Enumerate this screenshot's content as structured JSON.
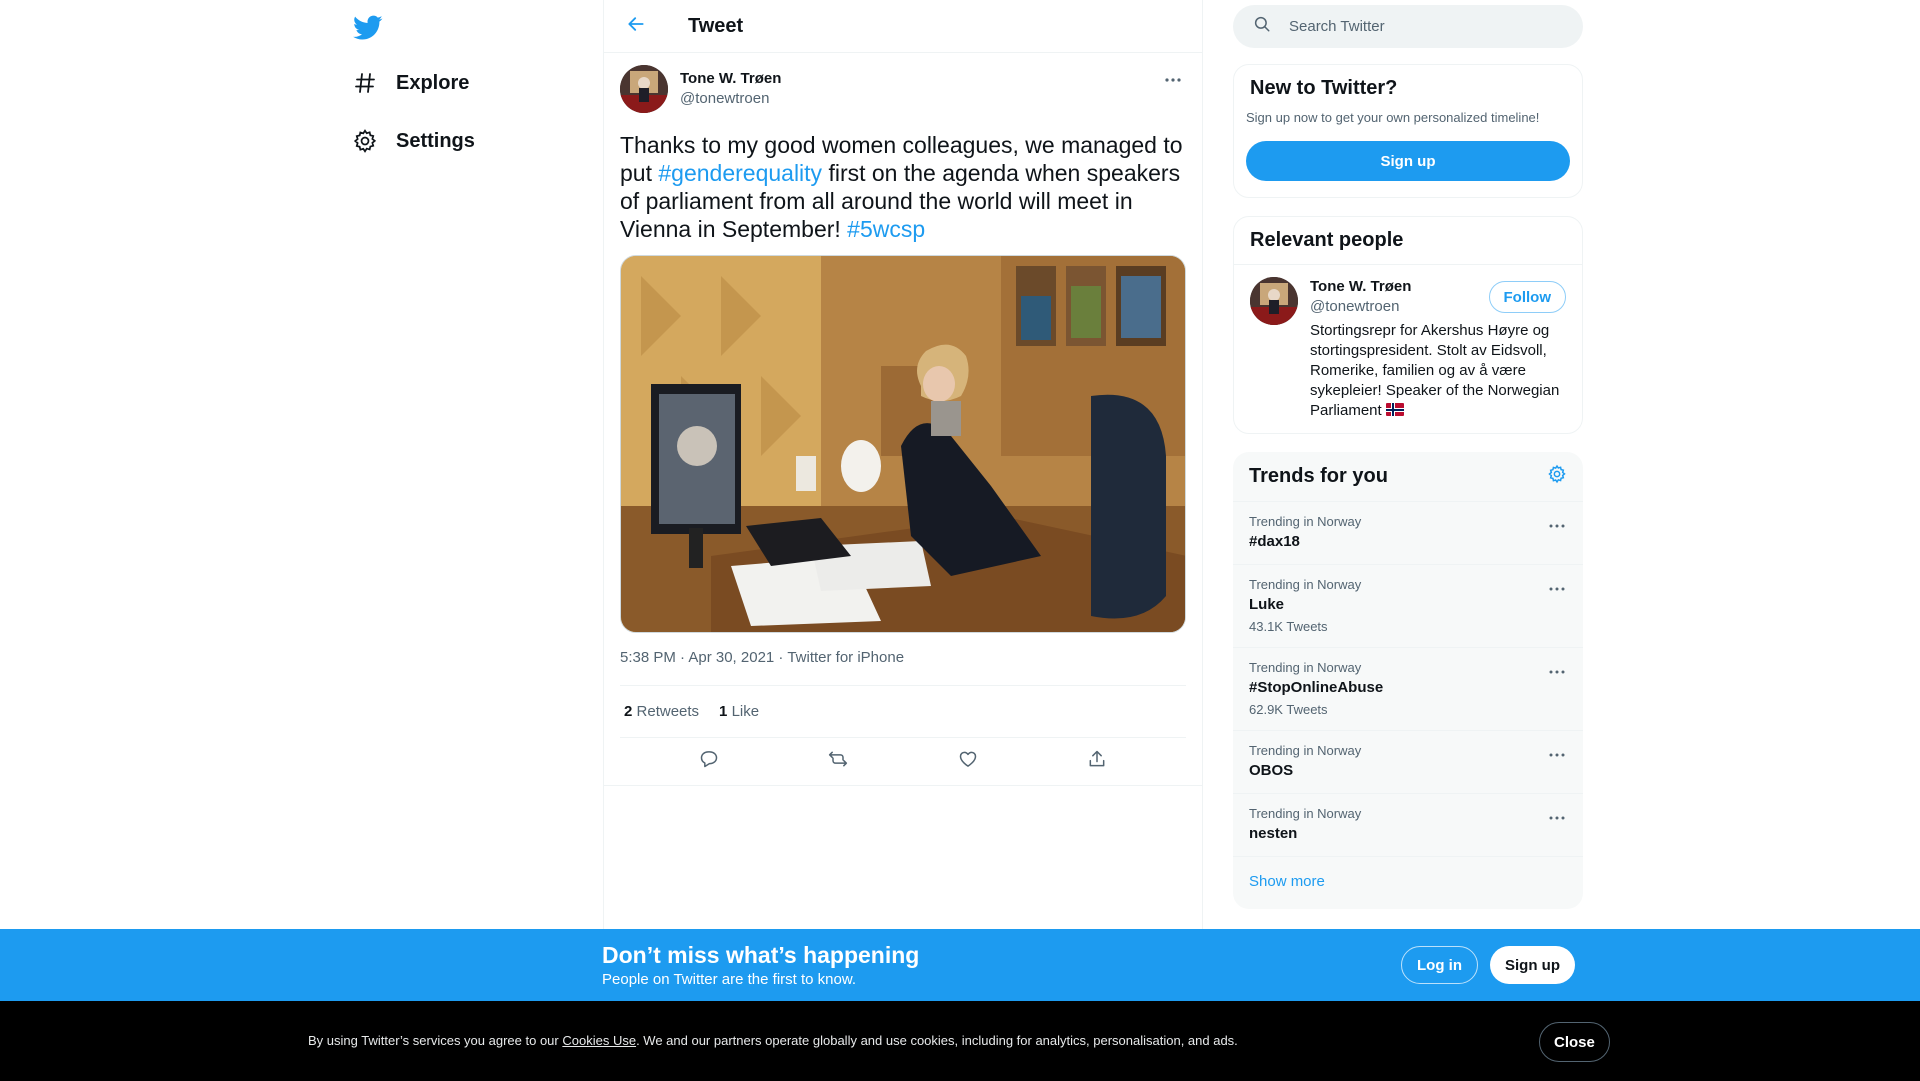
{
  "nav": {
    "logo_icon": "twitter-bird-icon",
    "items": [
      {
        "label": "Explore",
        "icon": "hashtag-icon"
      },
      {
        "label": "Settings",
        "icon": "gear-icon"
      }
    ]
  },
  "header": {
    "title": "Tweet",
    "back_icon": "arrow-left-icon"
  },
  "tweet": {
    "author_name": "Tone W. Trøen",
    "author_handle": "@tonewtroen",
    "text_parts": [
      "Thanks to my good women colleagues, we managed to put ",
      "#genderequality",
      " first on the agenda when speakers of parliament from all around the world will meet in Vienna in September! ",
      "#5wcsp"
    ],
    "timestamp": "5:38 PM · Apr 30, 2021 · Twitter for iPhone",
    "retweets_count": "2",
    "retweets_label": "Retweets",
    "likes_count": "1",
    "likes_label": "Like"
  },
  "search": {
    "placeholder": "Search Twitter"
  },
  "new_to_twitter": {
    "title": "New to Twitter?",
    "subtitle": "Sign up now to get your own personalized timeline!",
    "button": "Sign up"
  },
  "relevant_people": {
    "title": "Relevant people",
    "person": {
      "name": "Tone W. Trøen",
      "handle": "@tonewtroen",
      "bio": "Stortingsrepr for Akershus Høyre og stortingspresident. Stolt av Eidsvoll, Romerike, familien og av å være sykepleier! Speaker of the Norwegian Parliament",
      "follow_label": "Follow"
    }
  },
  "trends": {
    "title": "Trends for you",
    "items": [
      {
        "context": "Trending in Norway",
        "name": "#dax18",
        "count": ""
      },
      {
        "context": "Trending in Norway",
        "name": "Luke",
        "count": "43.1K Tweets"
      },
      {
        "context": "Trending in Norway",
        "name": "#StopOnlineAbuse",
        "count": "62.9K Tweets"
      },
      {
        "context": "Trending in Norway",
        "name": "OBOS",
        "count": ""
      },
      {
        "context": "Trending in Norway",
        "name": "nesten",
        "count": ""
      }
    ],
    "show_more": "Show more"
  },
  "banner": {
    "title": "Don’t miss what’s happening",
    "subtitle": "People on Twitter are the first to know.",
    "login": "Log in",
    "signup": "Sign up"
  },
  "cookie": {
    "text_before": "By using Twitter’s services you agree to our ",
    "link": "Cookies Use",
    "text_after": ". We and our partners operate globally and use cookies, including for analytics, personalisation, and ads.",
    "close": "Close"
  },
  "colors": {
    "accent": "#1d9bf0",
    "text": "#0f1419",
    "secondary": "#536471"
  }
}
